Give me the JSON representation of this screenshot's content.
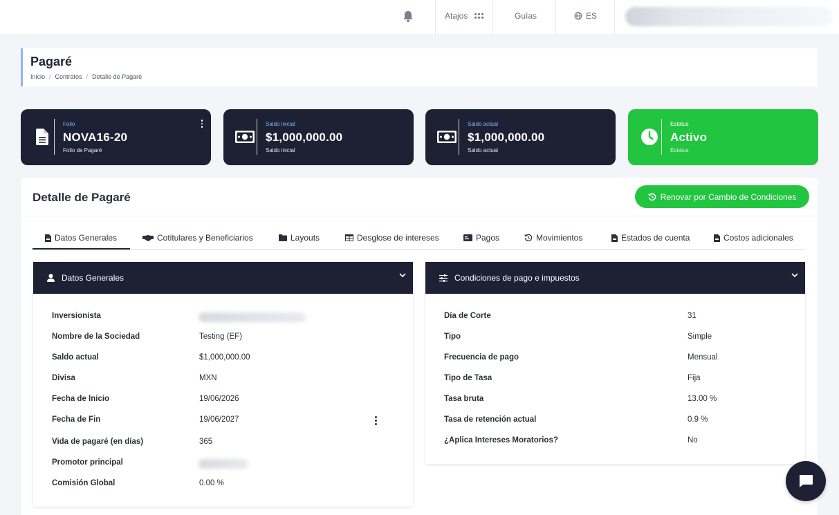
{
  "topbar": {
    "atajos_label": "Atajos",
    "guias_label": "Guías",
    "lang_label": "ES"
  },
  "header": {
    "title": "Pagaré",
    "breadcrumb": [
      "Inicio",
      "Contratos",
      "Detalle de Pagaré"
    ]
  },
  "stats": [
    {
      "top_label": "Folio",
      "value": "NOVA16-20",
      "bottom_label": "Folio de Pagaré",
      "icon": "document-icon"
    },
    {
      "top_label": "Saldo inicial",
      "value": "$1,000,000.00",
      "bottom_label": "Saldo inicial",
      "icon": "money-bill-icon"
    },
    {
      "top_label": "Saldo actual",
      "value": "$1,000,000.00",
      "bottom_label": "Saldo actual",
      "icon": "money-bill-icon"
    },
    {
      "top_label": "Estatus",
      "value": "Activo",
      "bottom_label": "Estatus",
      "icon": "clock-icon"
    }
  ],
  "main": {
    "title": "Detalle de Pagaré",
    "renew_button": "Renovar por Cambio de Condiciones",
    "tabs": [
      {
        "label": "Datos Generales",
        "icon": "file-icon"
      },
      {
        "label": "Cotitulares y Beneficiarios",
        "icon": "handshake-icon"
      },
      {
        "label": "Layouts",
        "icon": "folder-icon"
      },
      {
        "label": "Desglose de intereses",
        "icon": "table-icon"
      },
      {
        "label": "Pagos",
        "icon": "card-icon"
      },
      {
        "label": "Movimientos",
        "icon": "history-icon"
      },
      {
        "label": "Estados de cuenta",
        "icon": "file-icon"
      },
      {
        "label": "Costos adicionales",
        "icon": "file-icon"
      }
    ]
  },
  "general": {
    "title": "Datos Generales",
    "rows": [
      {
        "key": "Inversionista",
        "value": ""
      },
      {
        "key": "Nombre de la Sociedad",
        "value": "Testing (EF)"
      },
      {
        "key": "Saldo actual",
        "value": "$1,000,000.00"
      },
      {
        "key": "Divisa",
        "value": "MXN"
      },
      {
        "key": "Fecha de Inicio",
        "value": "19/06/2026"
      },
      {
        "key": "Fecha de Fin",
        "value": "19/06/2027"
      },
      {
        "key": "Vida de pagaré (en días)",
        "value": "365"
      },
      {
        "key": "Promotor principal",
        "value": ""
      },
      {
        "key": "Comisión Global",
        "value": "0.00 %"
      }
    ]
  },
  "conditions": {
    "title": "Condiciones de pago e impuestos",
    "rows": [
      {
        "key": "Día de Corte",
        "value": "31"
      },
      {
        "key": "Tipo",
        "value": "Simple"
      },
      {
        "key": "Frecuencia de pago",
        "value": "Mensual"
      },
      {
        "key": "Tipo de Tasa",
        "value": "Fija"
      },
      {
        "key": "Tasa bruta",
        "value": "13.00 %"
      },
      {
        "key": "Tasa de retención actual",
        "value": "0.9 %"
      },
      {
        "key": "¿Aplica Intereses Moratorios?",
        "value": "No"
      }
    ]
  },
  "colors": {
    "dark": "#1d2133",
    "green": "#22c53f",
    "accent_blue": "#8fb5f2"
  }
}
